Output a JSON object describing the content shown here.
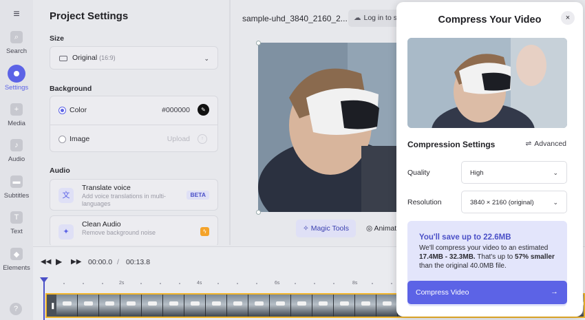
{
  "rail": {
    "items": [
      {
        "label": "Search",
        "icon": "search-icon",
        "glyph": "⌕"
      },
      {
        "label": "Settings",
        "icon": "settings-icon",
        "glyph": ""
      },
      {
        "label": "Media",
        "icon": "plus-icon",
        "glyph": "+"
      },
      {
        "label": "Audio",
        "icon": "music-note-icon",
        "glyph": "♪"
      },
      {
        "label": "Subtitles",
        "icon": "subtitles-icon",
        "glyph": "▬"
      },
      {
        "label": "Text",
        "icon": "text-icon",
        "glyph": "T"
      },
      {
        "label": "Elements",
        "icon": "elements-icon",
        "glyph": "◆"
      }
    ],
    "active": "Settings",
    "help_glyph": "?"
  },
  "panel": {
    "title": "Project Settings",
    "size": {
      "heading": "Size",
      "value": "Original",
      "sub": "(16:9)"
    },
    "background": {
      "heading": "Background",
      "color_label": "Color",
      "color_value": "#000000",
      "image_label": "Image",
      "image_action": "Upload"
    },
    "audio": {
      "heading": "Audio",
      "translate": {
        "title": "Translate voice",
        "desc": "Add voice translations in multi-languages",
        "badge": "BETA"
      },
      "clean": {
        "title": "Clean Audio",
        "desc": "Remove background noise"
      }
    }
  },
  "canvas": {
    "filename": "sample-uhd_3840_2160_2...",
    "login_label": "Log in to save",
    "magic_tools": "Magic Tools",
    "animation": "Animation"
  },
  "timeline": {
    "current_time": "00:00.0",
    "separator": "/",
    "duration": "00:13.8",
    "ticks": [
      "2s",
      "4s",
      "6s",
      "8s"
    ]
  },
  "modal": {
    "title": "Compress Your Video",
    "close_glyph": "×",
    "settings_heading": "Compression Settings",
    "advanced_label": "Advanced",
    "quality": {
      "label": "Quality",
      "value": "High"
    },
    "resolution": {
      "label": "Resolution",
      "value": "3840 × 2160 (original)"
    },
    "savings": {
      "headline": "You'll save up to 22.6MB",
      "line1": "We'll compress your video to an estimated ",
      "estimate": "17.4MB - 32.3MB.",
      "line2": " That's up to ",
      "percent": "57% smaller",
      "line3": " than the original 40.0MB file."
    },
    "compress_button": "Compress Video"
  },
  "colors": {
    "accent": "#5c63e6",
    "timeline_border": "#f0b429",
    "savings_bg": "#e3e5fb"
  }
}
